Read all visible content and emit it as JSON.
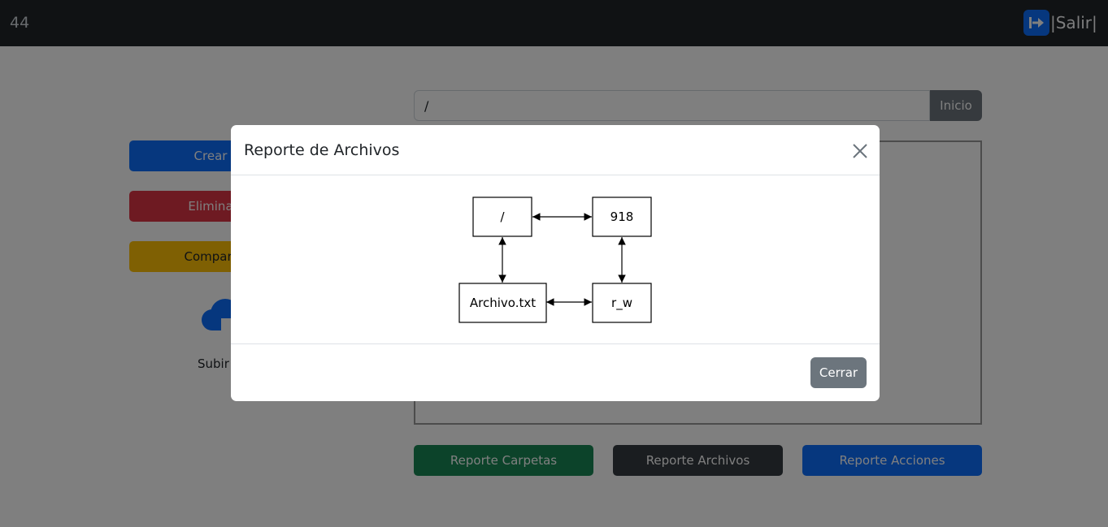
{
  "navbar": {
    "brand": "44",
    "logout_label": "|Salir|"
  },
  "sidebar": {
    "create_label": "Crear",
    "delete_label": "Elimina",
    "share_label": "Compart",
    "upload_label": "Subir"
  },
  "path": {
    "value": "/",
    "home_label": "Inicio"
  },
  "reports": {
    "folders_label": "Reporte Carpetas",
    "files_label": "Reporte Archivos",
    "actions_label": "Reporte Acciones"
  },
  "modal": {
    "title": "Reporte de Archivos",
    "close_label": "Cerrar",
    "graph": {
      "nodes": [
        {
          "id": "root",
          "label": "/"
        },
        {
          "id": "inode",
          "label": "918"
        },
        {
          "id": "file",
          "label": "Archivo.txt"
        },
        {
          "id": "perm",
          "label": "r_w"
        }
      ],
      "edges": [
        {
          "from": "root",
          "to": "inode",
          "direction": "both"
        },
        {
          "from": "root",
          "to": "file",
          "direction": "both"
        },
        {
          "from": "inode",
          "to": "perm",
          "direction": "both"
        },
        {
          "from": "file",
          "to": "perm",
          "direction": "both"
        }
      ]
    }
  },
  "colors": {
    "navbar": "#212529",
    "primary": "#0d6efd",
    "danger": "#dc3545",
    "warning": "#ffc107",
    "success": "#198754",
    "secondary": "#6c757d"
  }
}
